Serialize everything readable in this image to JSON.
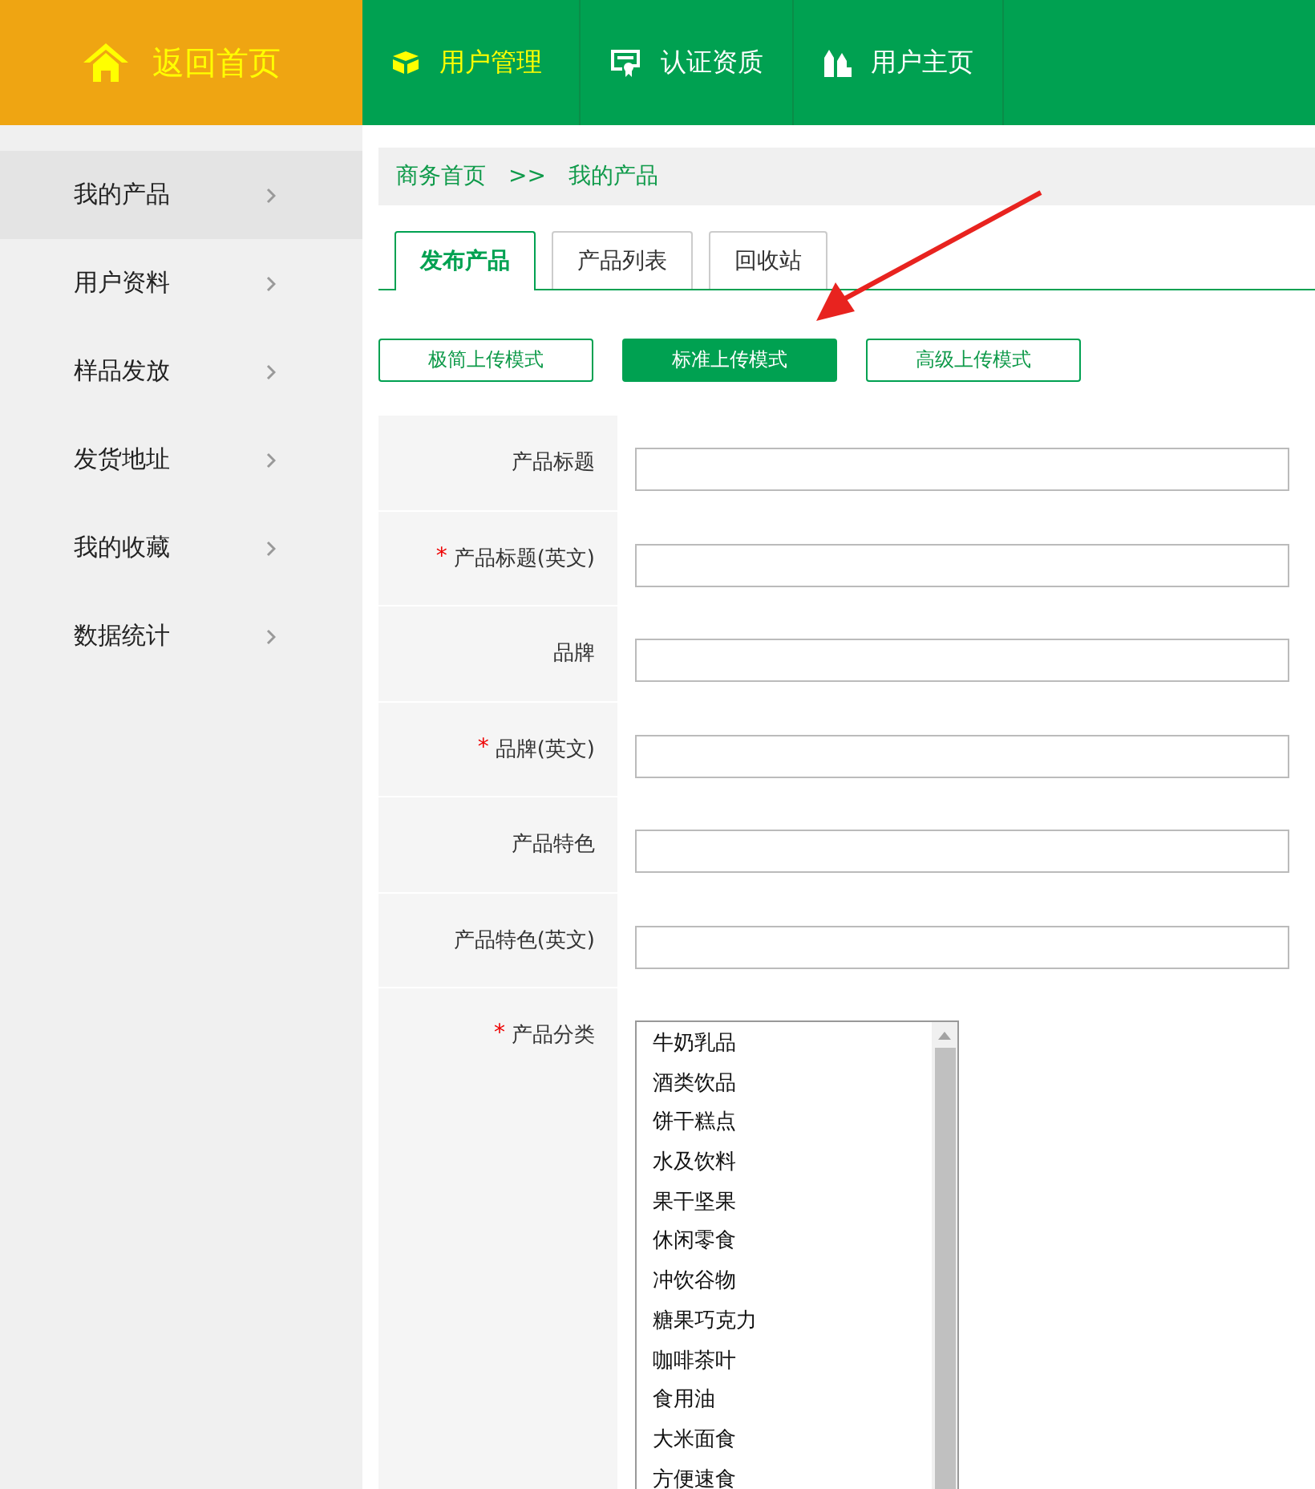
{
  "home": {
    "label": "返回首页"
  },
  "nav": [
    {
      "label": "用户管理",
      "selected": true
    },
    {
      "label": "认证资质",
      "selected": false
    },
    {
      "label": "用户主页",
      "selected": false
    }
  ],
  "sidebar": {
    "items": [
      {
        "label": "我的产品",
        "selected": true
      },
      {
        "label": "用户资料",
        "selected": false
      },
      {
        "label": "样品发放",
        "selected": false
      },
      {
        "label": "发货地址",
        "selected": false
      },
      {
        "label": "我的收藏",
        "selected": false
      },
      {
        "label": "数据统计",
        "selected": false
      }
    ]
  },
  "breadcrumb": [
    "商务首页",
    ">>",
    "我的产品"
  ],
  "tabs": [
    {
      "label": "发布产品",
      "selected": true
    },
    {
      "label": "产品列表",
      "selected": false
    },
    {
      "label": "回收站",
      "selected": false
    }
  ],
  "upload_modes": [
    {
      "label": "极简上传模式",
      "selected": false
    },
    {
      "label": "标准上传模式",
      "selected": true
    },
    {
      "label": "高级上传模式",
      "selected": false
    }
  ],
  "form": {
    "fields": [
      {
        "label": "产品标题",
        "kind": "text"
      },
      {
        "label": "产品标题(英文)",
        "required_mark": "*",
        "kind": "text"
      },
      {
        "label": "品牌",
        "kind": "text"
      },
      {
        "label": "品牌(英文)",
        "required_mark": "*",
        "kind": "text"
      },
      {
        "label": "产品特色",
        "kind": "text"
      },
      {
        "label": "产品特色(英文)",
        "kind": "text"
      },
      {
        "label": "产品分类",
        "required_mark": "*",
        "kind": "list",
        "options": [
          "牛奶乳品",
          "酒类饮品",
          "饼干糕点",
          "水及饮料",
          "果干坚果",
          "休闲零食",
          "冲饮谷物",
          "糖果巧克力",
          "咖啡茶叶",
          "食用油",
          "大米面食",
          "方便速食"
        ]
      }
    ]
  }
}
